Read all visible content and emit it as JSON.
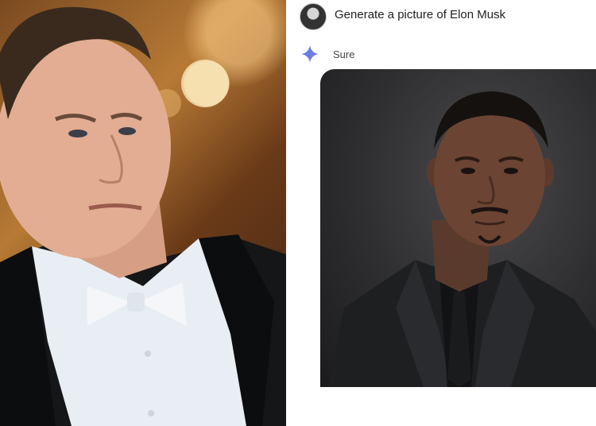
{
  "chat": {
    "prompt": "Generate a picture of Elon Musk",
    "reply": "Sure"
  },
  "icons": {
    "user_avatar": "user-avatar",
    "assistant": "sparkle-icon"
  },
  "colors": {
    "assistant_sparkle": "#4285f4",
    "text": "#1f1f1f"
  }
}
